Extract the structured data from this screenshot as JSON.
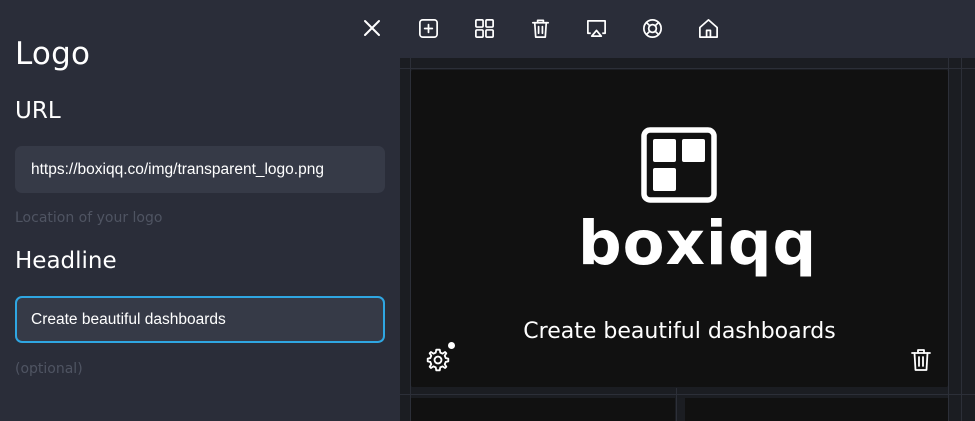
{
  "panel": {
    "title": "Logo",
    "url_label": "URL",
    "url_value": "https://boxiqq.co/img/transparent_logo.png",
    "url_hint": "Location of your logo",
    "headline_label": "Headline",
    "headline_value": "Create beautiful dashboards",
    "headline_hint": "(optional)"
  },
  "toolbar": {
    "icons": [
      "add-widget-icon",
      "grid-layout-icon",
      "trash-icon",
      "cast-icon",
      "help-lifebuoy-icon",
      "home-icon"
    ]
  },
  "tile": {
    "brand": "boxiqq",
    "headline": "Create beautiful dashboards"
  },
  "colors": {
    "panel_bg": "#2a2d39",
    "field_bg": "#363a47",
    "focus_border": "#2fa6e2",
    "tile_bg": "#111111",
    "canvas_bg": "#1b1d22"
  }
}
